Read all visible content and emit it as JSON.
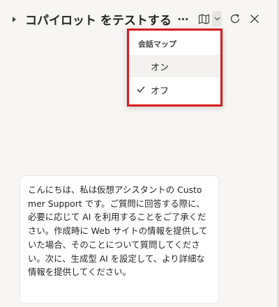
{
  "header": {
    "title": "コパイロット をテストする",
    "more_icon": "more-horizontal-icon",
    "map_icon": "map-icon",
    "refresh_icon": "refresh-icon",
    "close_icon": "close-icon",
    "glyphs": {
      "more": "⋯"
    }
  },
  "menu": {
    "header": "会話マップ",
    "items": [
      {
        "label": "オン",
        "checked": false,
        "highlighted": true
      },
      {
        "label": "オフ",
        "checked": true,
        "highlighted": false
      }
    ],
    "highlight_color": "#d81b1b"
  },
  "message": {
    "text": "こんにちは、私は仮想アシスタントの Customer Support です。ご質問に回答する際に、必要に応じて AI を利用することをご了承ください。作成時に Web サイトの情報を提供していた場合、そのことについて質問してください。次に、生成型 AI を設定して、より詳細な情報を提供してください。"
  }
}
